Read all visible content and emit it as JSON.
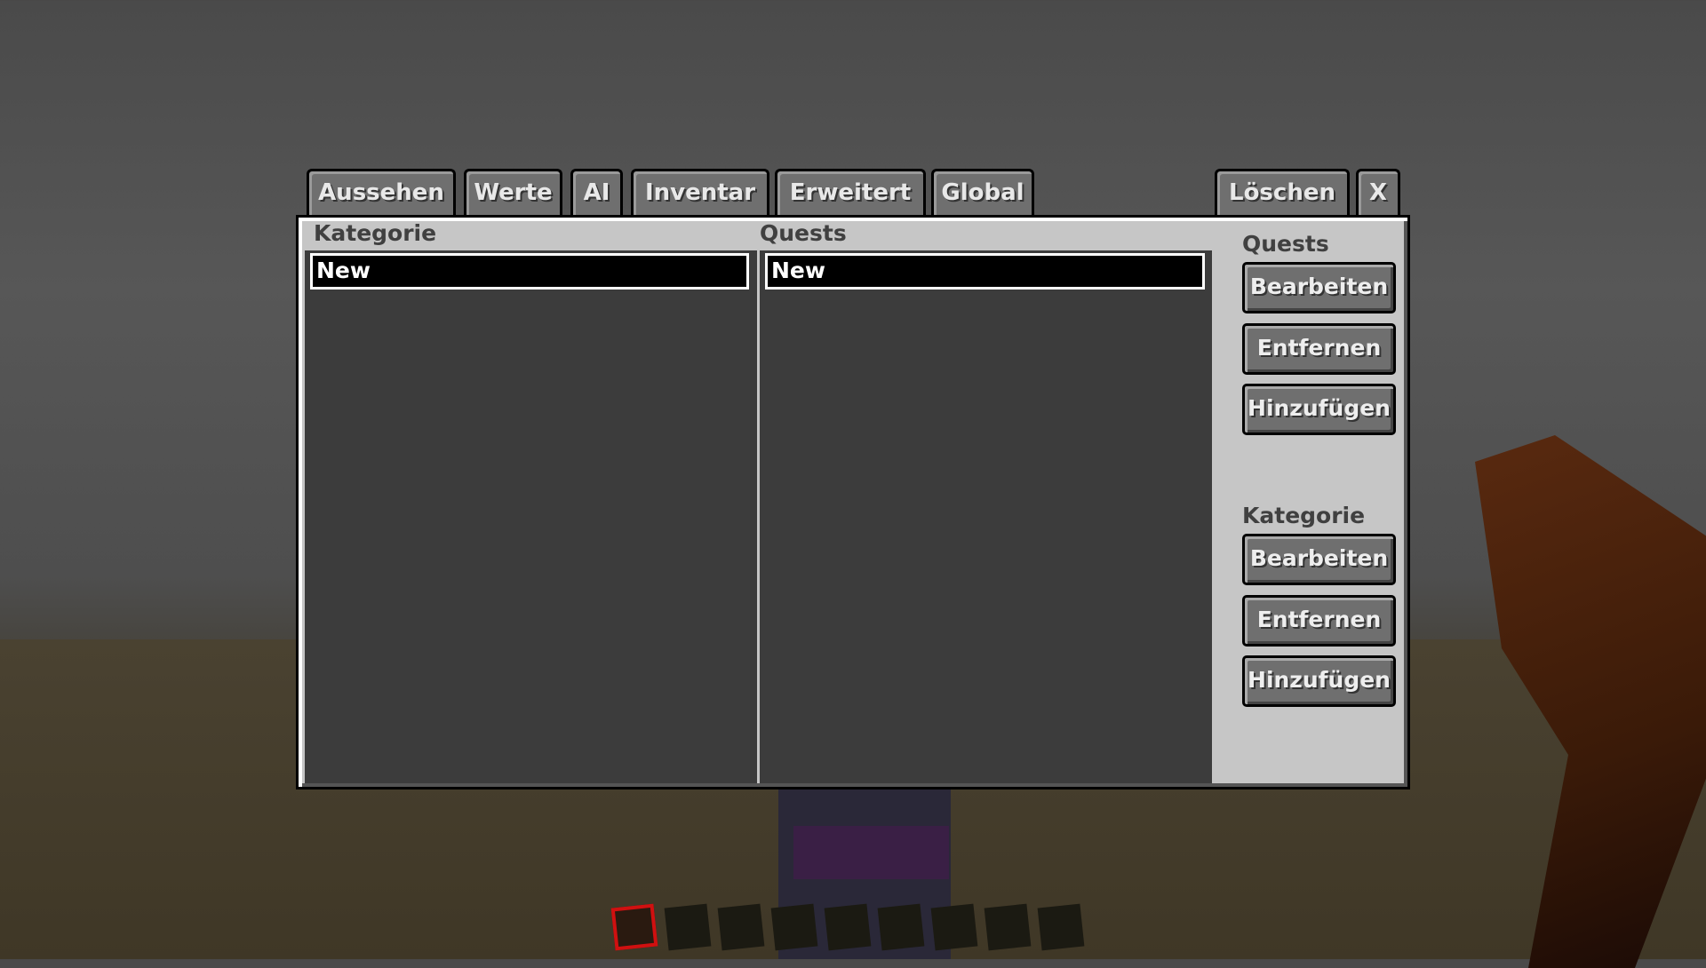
{
  "tabs": [
    "Aussehen",
    "Werte",
    "AI",
    "Inventar",
    "Erweitert",
    "Global"
  ],
  "actions": {
    "delete": "Löschen",
    "close": "X"
  },
  "columns": {
    "category": "Kategorie",
    "quests": "Quests"
  },
  "category_list": [
    "New"
  ],
  "quest_list": [
    "New"
  ],
  "side": {
    "quests_label": "Quests",
    "quests_edit": "Bearbeiten",
    "quests_remove": "Entfernen",
    "quests_add": "Hinzufügen",
    "category_label": "Kategorie",
    "category_edit": "Bearbeiten",
    "category_remove": "Entfernen",
    "category_add": "Hinzufügen"
  },
  "hotbar": {
    "selected_slot": 1,
    "slots": 9
  }
}
